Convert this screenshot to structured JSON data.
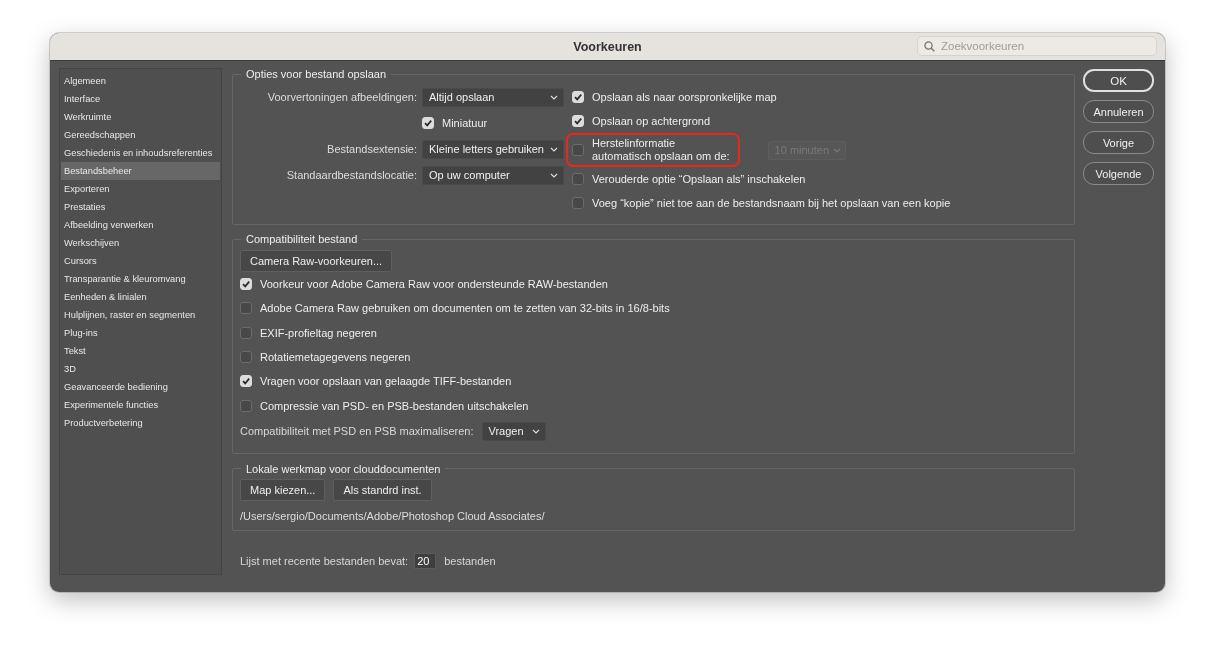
{
  "window": {
    "title": "Voorkeuren",
    "search_placeholder": "Zoekvoorkeuren"
  },
  "sidebar": {
    "items": [
      {
        "label": "Algemeen",
        "selected": false
      },
      {
        "label": "Interface",
        "selected": false
      },
      {
        "label": "Werkruimte",
        "selected": false
      },
      {
        "label": "Gereedschappen",
        "selected": false
      },
      {
        "label": "Geschiedenis en inhoudsreferenties",
        "selected": false
      },
      {
        "label": "Bestandsbeheer",
        "selected": true
      },
      {
        "label": "Exporteren",
        "selected": false
      },
      {
        "label": "Prestaties",
        "selected": false
      },
      {
        "label": "Afbeelding verwerken",
        "selected": false
      },
      {
        "label": "Werkschijven",
        "selected": false
      },
      {
        "label": "Cursors",
        "selected": false
      },
      {
        "label": "Transparantie & kleuromvang",
        "selected": false
      },
      {
        "label": "Eenheden & linialen",
        "selected": false
      },
      {
        "label": "Hulplijnen, raster en segmenten",
        "selected": false
      },
      {
        "label": "Plug-ins",
        "selected": false
      },
      {
        "label": "Tekst",
        "selected": false
      },
      {
        "label": "3D",
        "selected": false
      },
      {
        "label": "Geavanceerde bediening",
        "selected": false
      },
      {
        "label": "Experimentele functies",
        "selected": false
      },
      {
        "label": "Productverbetering",
        "selected": false
      }
    ]
  },
  "save_options": {
    "title": "Opties voor bestand opslaan",
    "left": [
      {
        "kind": "select",
        "label": "Voorvertoningen afbeeldingen:",
        "value": "Altijd opslaan"
      },
      {
        "kind": "checkbox",
        "label": "Miniatuur",
        "checked": true
      },
      {
        "kind": "select",
        "label": "Bestandsextensie:",
        "value": "Kleine letters gebruiken"
      },
      {
        "kind": "select",
        "label": "Standaardbestandslocatie:",
        "value": "Op uw computer"
      }
    ],
    "right": [
      {
        "label": "Opslaan als naar oorspronkelijke map",
        "checked": true,
        "highlighted": false
      },
      {
        "label": "Opslaan op achtergrond",
        "checked": true,
        "highlighted": false
      },
      {
        "label": "Herstelinformatie\nautomatisch opslaan om de:",
        "checked": false,
        "highlighted": true,
        "dropdown": {
          "value": "10 minuten",
          "disabled": true
        }
      },
      {
        "label": "Verouderde optie “Opslaan als” inschakelen",
        "checked": false,
        "highlighted": false
      },
      {
        "label": "Voeg “kopie” niet toe aan de bestandsnaam bij het opslaan van een kopie",
        "checked": false,
        "highlighted": false
      }
    ]
  },
  "compatibility": {
    "title": "Compatibiliteit bestand",
    "button": "Camera Raw-voorkeuren...",
    "checkboxes": [
      {
        "label": "Voorkeur voor Adobe Camera Raw voor ondersteunde RAW-bestanden",
        "checked": true
      },
      {
        "label": "Adobe Camera Raw gebruiken om documenten om te zetten van 32-bits in 16/8-bits",
        "checked": false
      },
      {
        "label": "EXIF-profieltag negeren",
        "checked": false
      },
      {
        "label": "Rotatiemetagegevens negeren",
        "checked": false
      },
      {
        "label": "Vragen voor opslaan van gelaagde TIFF-bestanden",
        "checked": true
      },
      {
        "label": "Compressie van PSD- en PSB-bestanden uitschakelen",
        "checked": false
      }
    ],
    "maximize": {
      "label": "Compatibiliteit met PSD en PSB maximaliseren:",
      "value": "Vragen"
    }
  },
  "cloud": {
    "title": "Lokale werkmap voor clouddocumenten",
    "buttons": [
      "Map kiezen...",
      "Als standrd inst."
    ],
    "path": "/Users/sergio/Documents/Adobe/Photoshop Cloud Associates/"
  },
  "recent": {
    "label": "Lijst met recente bestanden bevat:",
    "value": "20",
    "suffix": "bestanden"
  },
  "buttons": [
    {
      "label": "OK",
      "default": true
    },
    {
      "label": "Annuleren",
      "default": false
    },
    {
      "label": "Vorige",
      "default": false
    },
    {
      "label": "Volgende",
      "default": false
    }
  ]
}
